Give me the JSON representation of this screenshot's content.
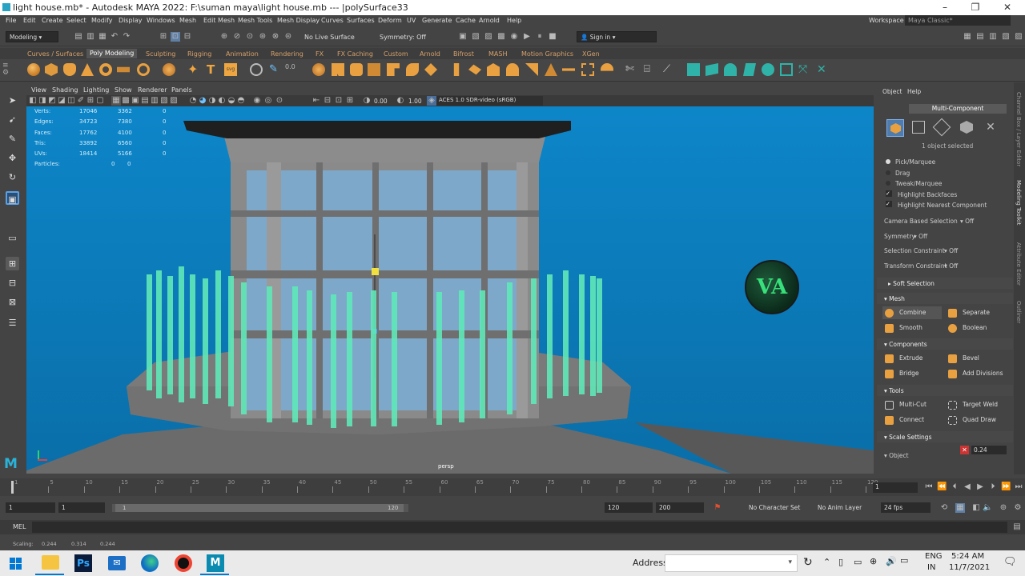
{
  "window": {
    "title": "light house.mb* - Autodesk MAYA 2022: F:\\suman maya\\light house.mb  ---  |polySurface33"
  },
  "menubar": {
    "items": [
      "File",
      "Edit",
      "Create",
      "Select",
      "Modify",
      "Display",
      "Windows",
      "Mesh",
      "Edit Mesh",
      "Mesh Tools",
      "Mesh Display",
      "Curves",
      "Surfaces",
      "Deform",
      "UV",
      "Generate",
      "Cache",
      "Arnold",
      "Help"
    ],
    "workspace_label": "Workspace :",
    "workspace_value": "Maya Classic*"
  },
  "statusline": {
    "mode": "Modeling",
    "live_surface": "No Live Surface",
    "symmetry": "Symmetry: Off",
    "signin": "Sign in"
  },
  "shelf_tabs": {
    "items": [
      "Curves / Surfaces",
      "Poly Modeling",
      "Sculpting",
      "Rigging",
      "Animation",
      "Rendering",
      "FX",
      "FX Caching",
      "Custom",
      "Arnold",
      "Bifrost",
      "MASH",
      "Motion Graphics",
      "XGen"
    ],
    "active": "Poly Modeling"
  },
  "viewport_menu": {
    "items": [
      "View",
      "Shading",
      "Lighting",
      "Show",
      "Renderer",
      "Panels"
    ]
  },
  "viewport_tools": {
    "value_a": "0.00",
    "value_b": "1.00",
    "color_space": "ACES 1.0 SDR-video (sRGB)"
  },
  "hud": {
    "rows": [
      {
        "label": "Verts:",
        "a": "17046",
        "b": "3362",
        "c": "0"
      },
      {
        "label": "Edges:",
        "a": "34723",
        "b": "7380",
        "c": "0"
      },
      {
        "label": "Faces:",
        "a": "17762",
        "b": "4100",
        "c": "0"
      },
      {
        "label": "Tris:",
        "a": "33892",
        "b": "6560",
        "c": "0"
      },
      {
        "label": "UVs:",
        "a": "18414",
        "b": "5166",
        "c": "0"
      },
      {
        "label": "Particles:",
        "a": "0",
        "b": "0",
        "c": ""
      }
    ],
    "camera": "persp"
  },
  "right_panel": {
    "tabs": [
      "Object",
      "Help"
    ],
    "header": "Multi-Component",
    "selection_info": "1 object selected",
    "options": [
      {
        "label": "Pick/Marquee",
        "kind": "radio",
        "checked": true
      },
      {
        "label": "Drag",
        "kind": "radio",
        "checked": false
      },
      {
        "label": "Tweak/Marquee",
        "kind": "radio",
        "checked": false
      },
      {
        "label": "Highlight Backfaces",
        "kind": "check",
        "checked": true
      },
      {
        "label": "Highlight Nearest Component",
        "kind": "check",
        "checked": true
      }
    ],
    "settings": [
      {
        "label": "Camera Based Selection",
        "value": "Off"
      },
      {
        "label": "Symmetry",
        "value": "Off"
      },
      {
        "label": "Selection Constraint",
        "value": "Off"
      },
      {
        "label": "Transform Constraint",
        "value": "Off"
      }
    ],
    "soft_selection": "Soft Selection",
    "sections": [
      {
        "title": "Mesh",
        "buttons": [
          "Combine",
          "Separate",
          "Smooth",
          "Boolean"
        ]
      },
      {
        "title": "Components",
        "buttons": [
          "Extrude",
          "Bevel",
          "Bridge",
          "Add Divisions"
        ]
      },
      {
        "title": "Tools",
        "buttons": [
          "Multi-Cut",
          "Target Weld",
          "Connect",
          "Quad Draw"
        ]
      }
    ],
    "scale_settings": "Scale Settings",
    "scale_object_label": "Object",
    "scale_object_value": "0.24"
  },
  "side_tabs": [
    "Channel Box / Layer Editor",
    "Modeling Toolkit",
    "Attribute Editor",
    "Outliner"
  ],
  "timeslider": {
    "ticks": [
      "1",
      "5",
      "10",
      "15",
      "20",
      "25",
      "30",
      "35",
      "40",
      "45",
      "50",
      "55",
      "60",
      "65",
      "70",
      "75",
      "80",
      "85",
      "90",
      "95",
      "100",
      "105",
      "110",
      "115",
      "120"
    ],
    "current_frame": "1"
  },
  "range": {
    "start": "1",
    "playback_start": "1",
    "range_start_marker": "1",
    "range_end_marker": "120",
    "playback_end": "120",
    "end": "200",
    "char_set": "No Character Set",
    "anim_layer": "No Anim Layer",
    "fps": "24 fps"
  },
  "cmdline": {
    "label": "MEL"
  },
  "helpline": {
    "label": "Scaling:",
    "x": "0.244",
    "y": "0.314",
    "z": "0.244"
  },
  "taskbar": {
    "address_label": "Address",
    "lang_top": "ENG",
    "lang_bottom": "IN",
    "time": "5:24 AM",
    "date": "11/7/2021"
  },
  "colors": {
    "viewport_top": "#0d86c9",
    "accent_orange": "#e8a040",
    "railing": "#5fe8b8"
  }
}
